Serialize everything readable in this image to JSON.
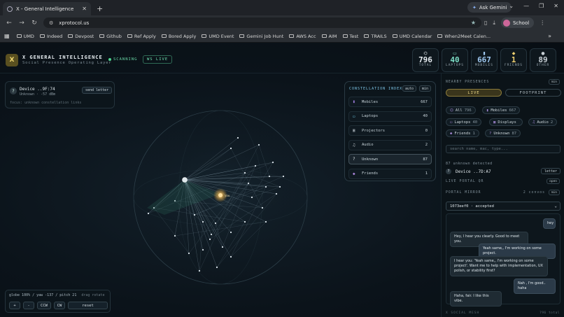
{
  "browser": {
    "tab_title": "X - General Intelligence",
    "tab_close": "✕",
    "new_tab": "+",
    "ask_gemini": "Ask Gemini",
    "url": "xprotocol.us",
    "profile": "School",
    "bookmarks": [
      "UMD",
      "Indeed",
      "Devpost",
      "Github",
      "Ref Apply",
      "Bored Apply",
      "UMD Event",
      "Gemini Job Hunt",
      "AWS Acc",
      "AIM",
      "Test",
      "TRAILS",
      "UMD Calendar",
      "When2Meet Calen..."
    ]
  },
  "header": {
    "logo": "X",
    "title": "X GENERAL INTELLIGENCE",
    "subtitle": "Social Presence Operating Layer",
    "scanning": "SCANNING",
    "ws": "WS LIVE"
  },
  "stats": [
    {
      "value": "796",
      "label": "TOTAL",
      "icon": "network-icon",
      "color": "#e8eef2"
    },
    {
      "value": "40",
      "label": "LAPTOPS",
      "icon": "laptop-icon",
      "color": "#7ee0c8"
    },
    {
      "value": "667",
      "label": "MOBILES",
      "icon": "mobile-icon",
      "color": "#9fc8f0"
    },
    {
      "value": "1",
      "label": "FRIENDS",
      "icon": "friend-icon",
      "color": "#f0d070"
    },
    {
      "value": "89",
      "label": "OTHER",
      "icon": "other-icon",
      "color": "#c8d0d6"
    }
  ],
  "device_card": {
    "name": "Device ..9F:74",
    "meta": "Unknown · -57 dBm",
    "action": "send letter",
    "focus": "focus: unknown constellation links"
  },
  "constellation": {
    "title": "CONSTELLATION INDEX",
    "auto": "auto",
    "min": "min",
    "rows": [
      {
        "label": "Mobiles",
        "count": "667",
        "icon": "mobile-icon",
        "glyph": "▮",
        "color": "#9a7ad8"
      },
      {
        "label": "Laptops",
        "count": "40",
        "icon": "laptop-icon",
        "glyph": "▭",
        "color": "#6ec6e0"
      },
      {
        "label": "Projectors",
        "count": "0",
        "icon": "projector-icon",
        "glyph": "▣",
        "color": "#9aa4aa"
      },
      {
        "label": "Audio",
        "count": "2",
        "icon": "headphones-icon",
        "glyph": "♫",
        "color": "#c8d0d6"
      },
      {
        "label": "Unknown",
        "count": "87",
        "icon": "question-icon",
        "glyph": "?",
        "color": "#dfe6ea",
        "active": true
      },
      {
        "label": "Friends",
        "count": "1",
        "icon": "friend-icon",
        "glyph": "◆",
        "color": "#b088e0"
      }
    ]
  },
  "globe": {
    "info": "globe 100% / yaw -137 / pitch 21",
    "hint": "drag rotate",
    "buttons": [
      "+",
      "-",
      "CCW",
      "CW",
      "reset"
    ],
    "friend_label": "you"
  },
  "nearby": {
    "label": "NEARBY PRESENCES",
    "min": "min",
    "live": "LIVE",
    "footprint": "FOOTPRINT",
    "chips": [
      {
        "label": "All",
        "count": "796",
        "icon": "network-icon",
        "glyph": "⌬"
      },
      {
        "label": "Mobiles",
        "count": "667",
        "icon": "mobile-icon",
        "glyph": "▮"
      },
      {
        "label": "Laptops",
        "count": "40",
        "icon": "laptop-icon",
        "glyph": "▭"
      },
      {
        "label": "Displays",
        "count": "",
        "icon": "display-icon",
        "glyph": "▣"
      },
      {
        "label": "Audio",
        "count": "2",
        "icon": "headphones-icon",
        "glyph": "♫"
      },
      {
        "label": "Friends",
        "count": "1",
        "icon": "friend-icon",
        "glyph": "◆"
      },
      {
        "label": "Unknown",
        "count": "87",
        "icon": "question-icon",
        "glyph": "?"
      }
    ],
    "search_placeholder": "search name, mac, type...",
    "unknown_detected": "87 unknown detected",
    "unknown_device": "Device ..7D:A7",
    "letter": "letter"
  },
  "portal": {
    "qr_label": "LIVE PORTAL QR",
    "open": "open",
    "mirror_label": "PORTAL MIRROR",
    "convos": "2 convos",
    "min": "min",
    "selected": "1073eef0 · accepted",
    "messages": [
      {
        "dir": "out",
        "text": "hey"
      },
      {
        "dir": "in",
        "text": "Hey, I hear you clearly. Good to meet you."
      },
      {
        "dir": "out",
        "text": "Yeah same,, I'm working on some project."
      },
      {
        "dir": "in",
        "text": "I hear you: 'Yeah same,, I'm working on some project'. Want me to help with implementation, UX polish, or stability first?"
      },
      {
        "dir": "out",
        "text": "Nah , I'm good.. haha"
      },
      {
        "dir": "in",
        "text": "Haha, fair. I like this vibe."
      }
    ],
    "footer_left": "X SOCIAL MESH",
    "footer_right": "796 total"
  }
}
